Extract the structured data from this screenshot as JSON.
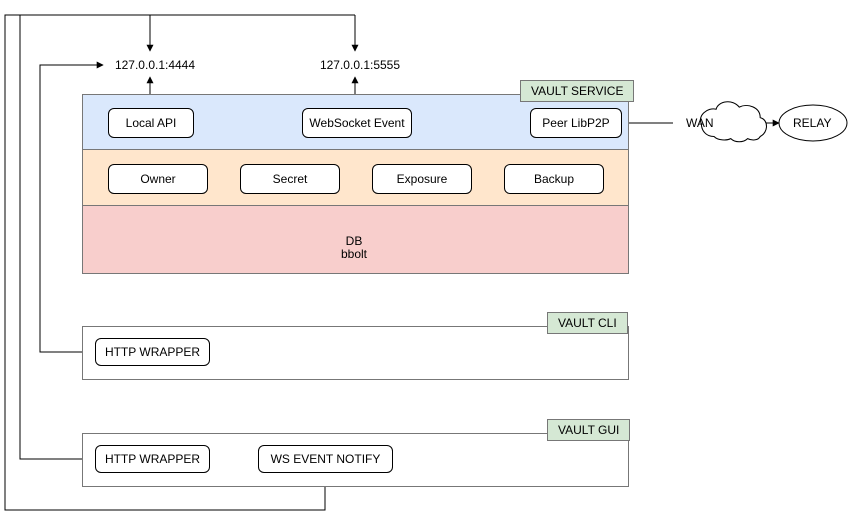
{
  "addresses": {
    "api": "127.0.0.1:4444",
    "ws": "127.0.0.1:5555"
  },
  "service": {
    "tag": "VAULT SERVICE",
    "local_api": "Local API",
    "ws_event": "WebSocket Event",
    "peer": "Peer LibP2P",
    "owner": "Owner",
    "secret": "Secret",
    "exposure": "Exposure",
    "backup": "Backup",
    "db_line1": "DB",
    "db_line2": "bbolt"
  },
  "wan": "WAN",
  "relay": "RELAY",
  "cli": {
    "tag": "VAULT CLI",
    "http_wrapper": "HTTP WRAPPER"
  },
  "gui": {
    "tag": "VAULT GUI",
    "http_wrapper": "HTTP WRAPPER",
    "ws_notify": "WS EVENT NOTIFY"
  }
}
